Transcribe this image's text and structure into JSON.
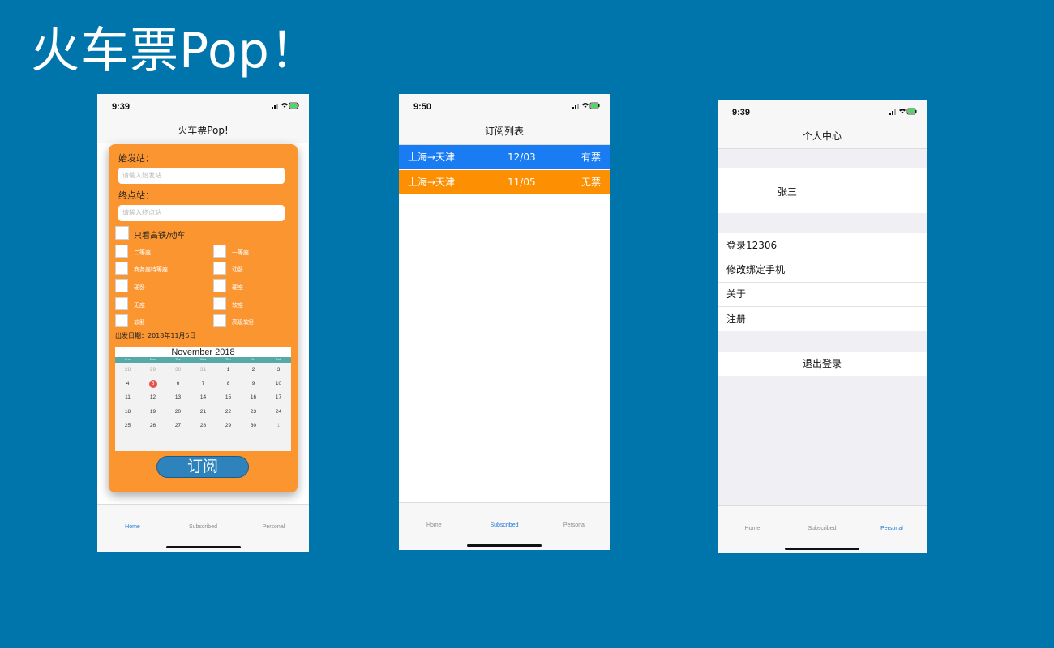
{
  "slide": {
    "title": "火车票Pop！"
  },
  "tabs": {
    "home": "Home",
    "subscribed": "Subscribed",
    "personal": "Personal"
  },
  "home_screen": {
    "time": "9:39",
    "nav_title": "火车票Pop!",
    "from_label": "始发站：",
    "from_placeholder": "请输入始发站",
    "to_label": "终点站：",
    "to_placeholder": "请输入终点站",
    "hsr_only": "只看高铁/动车",
    "seats": [
      "二等座",
      "一等座",
      "商务座特等座",
      "动卧",
      "硬卧",
      "硬座",
      "无座",
      "软座",
      "软卧",
      "高级软卧"
    ],
    "departure_date": "出发日期：2018年11月5日",
    "calendar": {
      "month": "November 2018",
      "weekdays": [
        "Sun",
        "Mon",
        "Tue",
        "Wed",
        "Thu",
        "Fri",
        "Sat"
      ],
      "rows": [
        [
          "28",
          "29",
          "30",
          "31",
          "1",
          "2",
          "3"
        ],
        [
          "4",
          "5",
          "6",
          "7",
          "8",
          "9",
          "10"
        ],
        [
          "11",
          "12",
          "13",
          "14",
          "15",
          "16",
          "17"
        ],
        [
          "18",
          "19",
          "20",
          "21",
          "22",
          "23",
          "24"
        ],
        [
          "25",
          "26",
          "27",
          "28",
          "29",
          "30",
          "1"
        ]
      ],
      "selected": "5"
    },
    "subscribe_button": "订阅"
  },
  "subscribed_screen": {
    "time": "9:50",
    "nav_title": "订阅列表",
    "items": [
      {
        "route": "上海→天津",
        "date": "12/03",
        "status": "有票",
        "color": "#1a7cf3"
      },
      {
        "route": "上海→天津",
        "date": "11/05",
        "status": "无票",
        "color": "#fd8f03"
      }
    ]
  },
  "personal_screen": {
    "time": "9:39",
    "nav_title": "个人中心",
    "user_name": "张三",
    "menu": [
      "登录12306",
      "修改绑定手机",
      "关于",
      "注册"
    ],
    "logout": "退出登录"
  },
  "colors": {
    "background": "#0075ab",
    "card_orange": "#fb9530",
    "tab_active": "#1f76d8"
  }
}
